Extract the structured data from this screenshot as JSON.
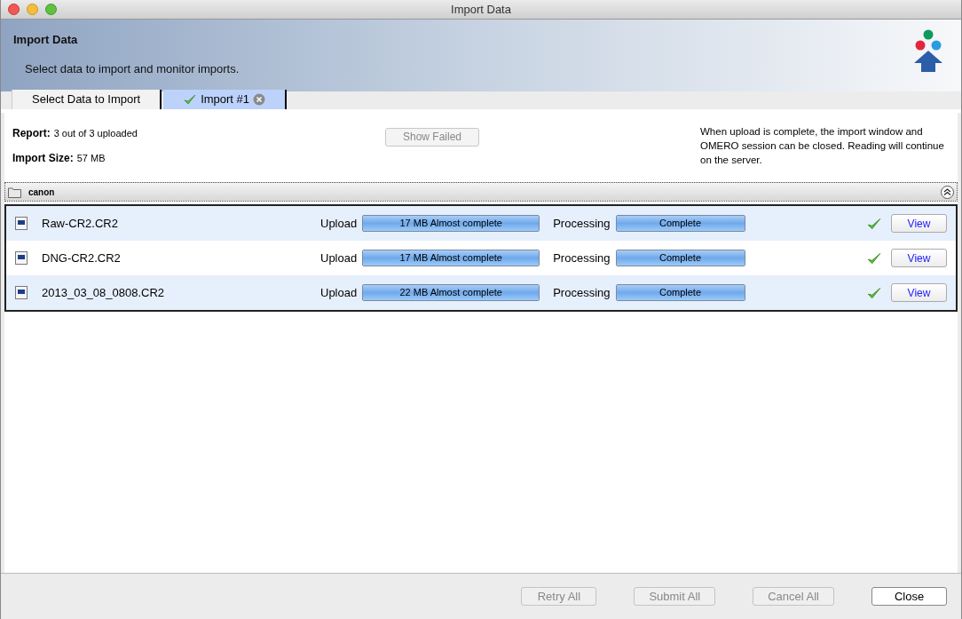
{
  "window": {
    "title": "Import Data"
  },
  "header": {
    "title": "Import Data",
    "subtitle": "Select data to import and monitor imports."
  },
  "tabs": [
    {
      "label": "Select Data to Import",
      "selected": false,
      "done": false,
      "closable": false
    },
    {
      "label": "Import #1",
      "selected": true,
      "done": true,
      "closable": true
    }
  ],
  "summary": {
    "report_label": "Report:",
    "report_value": "3 out of 3 uploaded",
    "size_label": "Import Size:",
    "size_value": "57 MB",
    "show_failed": {
      "label": "Show Failed",
      "disabled": true
    },
    "note": "When upload is complete, the import window and OMERO session can be closed. Reading will continue on the server."
  },
  "group": {
    "name": "canon",
    "expanded": true
  },
  "files": [
    {
      "name": "Raw-CR2.CR2",
      "upload_label": "Upload",
      "upload": {
        "text": "17 MB Almost complete",
        "level": 1
      },
      "processing_label": "Processing",
      "processing": {
        "text": "Complete",
        "level": 1
      },
      "done": true,
      "action": "View"
    },
    {
      "name": "DNG-CR2.CR2",
      "upload_label": "Upload",
      "upload": {
        "text": "17 MB Almost complete",
        "level": 1
      },
      "processing_label": "Processing",
      "processing": {
        "text": "Complete",
        "level": 1
      },
      "done": true,
      "action": "View"
    },
    {
      "name": "2013_03_08_0808.CR2",
      "upload_label": "Upload",
      "upload": {
        "text": "22 MB Almost complete",
        "level": 1
      },
      "processing_label": "Processing",
      "processing": {
        "text": "Complete",
        "level": 1
      },
      "done": true,
      "action": "View"
    }
  ],
  "buttons": [
    {
      "label": "Retry All",
      "disabled": true
    },
    {
      "label": "Submit All",
      "disabled": true
    },
    {
      "label": "Cancel All",
      "disabled": true
    },
    {
      "label": "Close",
      "disabled": false
    }
  ]
}
